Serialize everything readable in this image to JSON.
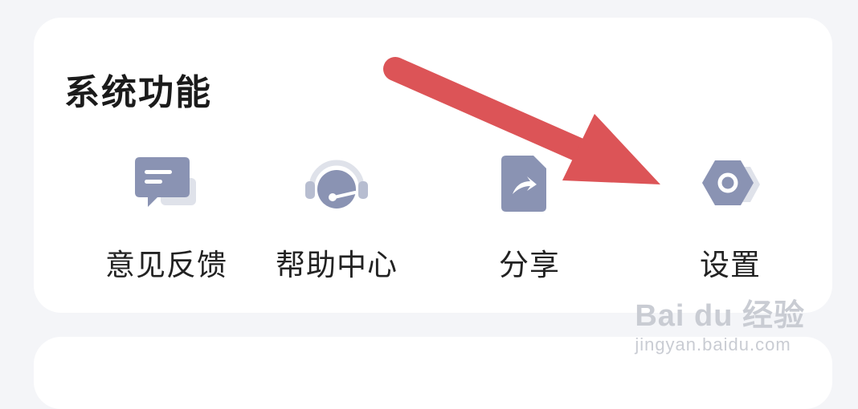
{
  "section": {
    "title": "系统功能",
    "items": [
      {
        "label": "意见反馈",
        "icon": "feedback-icon"
      },
      {
        "label": "帮助中心",
        "icon": "headset-icon"
      },
      {
        "label": "分享",
        "icon": "share-icon"
      },
      {
        "label": "设置",
        "icon": "gear-icon"
      }
    ]
  },
  "annotation": {
    "color": "#dc5457"
  },
  "watermark": {
    "brand": "Bai du 经验",
    "url": "jingyan.baidu.com"
  },
  "colors": {
    "icon_primary": "#8a93b3",
    "icon_shadow": "#dfe2ea",
    "background": "#f4f5f8",
    "card": "#ffffff"
  }
}
